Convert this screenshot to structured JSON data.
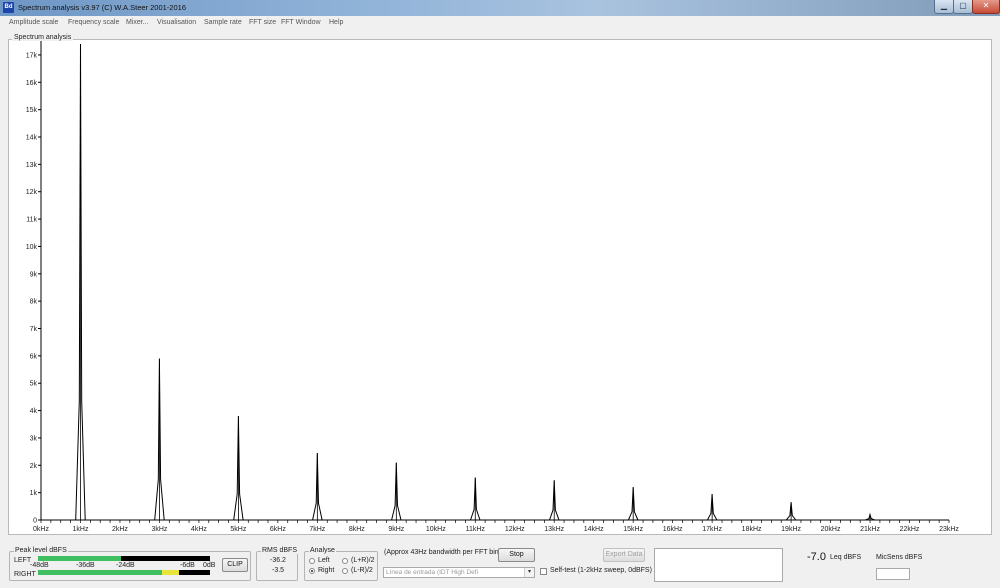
{
  "window": {
    "title": "Spectrum analysis v3.97  (C) W.A.Steer 2001-2016",
    "icon_name": "app-logo-icon",
    "icon_text": "Bd",
    "min_symbol": "▁",
    "max_symbol": "▢",
    "close_symbol": "✕"
  },
  "menu": [
    "Amplitude scale",
    "Frequency scale",
    "Mixer...",
    "Visualisation",
    "Sample rate",
    "FFT size",
    "FFT Window",
    "Help"
  ],
  "chart_legend": "Spectrum analysis",
  "chart_data": {
    "type": "line",
    "title": "Spectrum analysis",
    "xlabel": "",
    "ylabel": "",
    "xlim": [
      0,
      23
    ],
    "ylim": [
      0,
      17.4
    ],
    "grid": false,
    "y_ticks": [
      "0",
      "1k",
      "2k",
      "3k",
      "4k",
      "5k",
      "6k",
      "7k",
      "8k",
      "9k",
      "10k",
      "11k",
      "12k",
      "13k",
      "14k",
      "15k",
      "16k",
      "17k"
    ],
    "y_tick_values": [
      0,
      1,
      2,
      3,
      4,
      5,
      6,
      7,
      8,
      9,
      10,
      11,
      12,
      13,
      14,
      15,
      16,
      17
    ],
    "x_ticks": [
      "0kHz",
      "1kHz",
      "2kHz",
      "3kHz",
      "4kHz",
      "5kHz",
      "6kHz",
      "7kHz",
      "8kHz",
      "9kHz",
      "10kHz",
      "11kHz",
      "12kHz",
      "13kHz",
      "14kHz",
      "15kHz",
      "16kHz",
      "17kHz",
      "18kHz",
      "19kHz",
      "20kHz",
      "21kHz",
      "22kHz",
      "23kHz"
    ],
    "x_tick_values": [
      0,
      1,
      2,
      3,
      4,
      5,
      6,
      7,
      8,
      9,
      10,
      11,
      12,
      13,
      14,
      15,
      16,
      17,
      18,
      19,
      20,
      21,
      22,
      23
    ],
    "peaks": [
      {
        "freq_khz": 1,
        "amplitude_k": 17.4
      },
      {
        "freq_khz": 3,
        "amplitude_k": 5.9
      },
      {
        "freq_khz": 5,
        "amplitude_k": 3.8
      },
      {
        "freq_khz": 7,
        "amplitude_k": 2.45
      },
      {
        "freq_khz": 9,
        "amplitude_k": 2.1
      },
      {
        "freq_khz": 11,
        "amplitude_k": 1.55
      },
      {
        "freq_khz": 13,
        "amplitude_k": 1.45
      },
      {
        "freq_khz": 15,
        "amplitude_k": 1.2
      },
      {
        "freq_khz": 17,
        "amplitude_k": 0.95
      },
      {
        "freq_khz": 19,
        "amplitude_k": 0.65
      },
      {
        "freq_khz": 21,
        "amplitude_k": 0.2
      }
    ],
    "line_color": "#000000"
  },
  "peak_level": {
    "title": "Peak level dBFS",
    "left_label": "LEFT",
    "right_label": "RIGHT",
    "scale": [
      "-48dB",
      "-36dB",
      "-24dB",
      "-6dB",
      "0dB"
    ],
    "left_level": 0.48,
    "right_level": 0.82,
    "meter_green": "#3fbf5f",
    "meter_yellow": "#e8e43a",
    "clip_label": "CLIP"
  },
  "rms": {
    "title": "RMS dBFS",
    "left_value": "-36.2",
    "right_value": "-3.5"
  },
  "analyse": {
    "title": "Analyse",
    "options": [
      "Left",
      "Right",
      "(L+R)/2",
      "(L-R)/2"
    ],
    "selected": "Right"
  },
  "bandwidth_text": "(Approx 43Hz bandwidth per FFT bin)",
  "stop_label": "Stop",
  "export_label": "Export Data",
  "input_select": "Línea de entrada (IDT High Defi",
  "selftest_label": "Self-test (1-2kHz sweep, 0dBFS)",
  "leq_value": "-7.0",
  "leq_label": "Leq dBFS",
  "micsens_label": "MicSens dBFS"
}
